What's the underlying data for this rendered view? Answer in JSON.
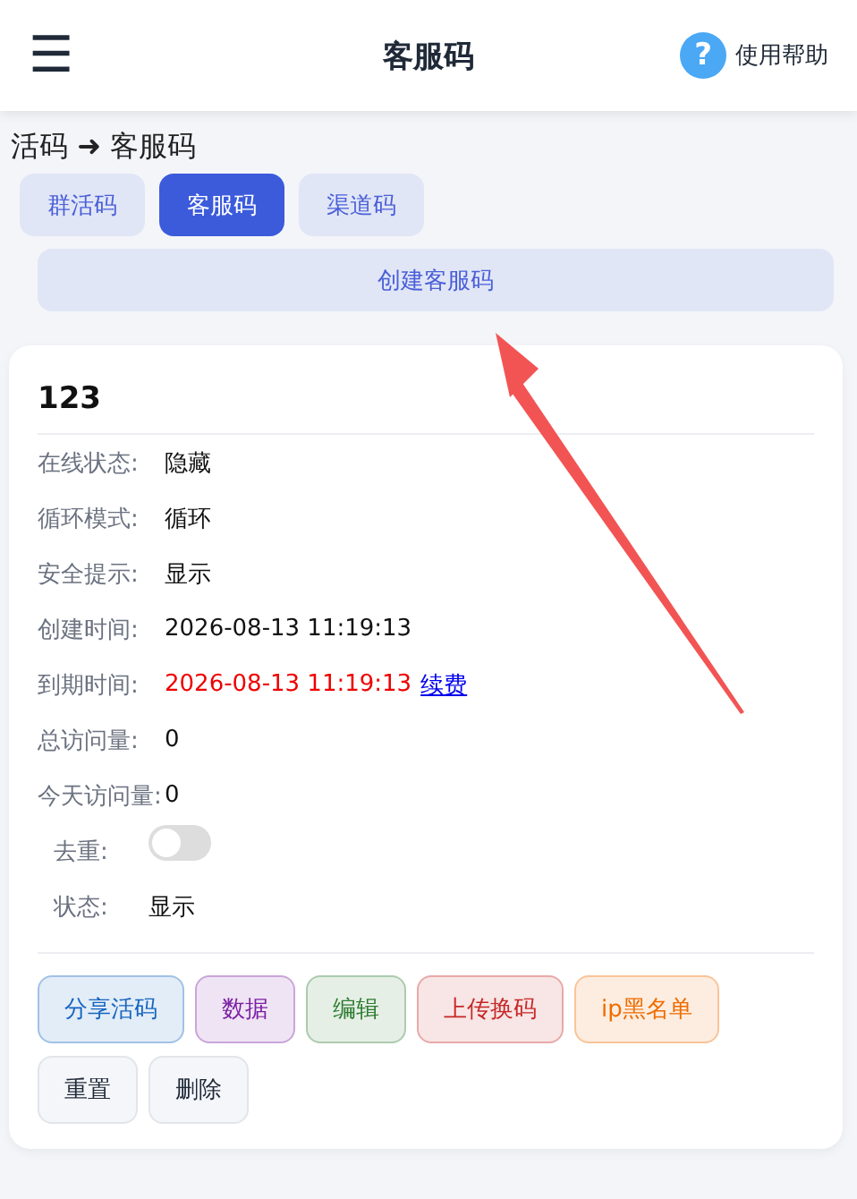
{
  "header": {
    "menu_icon": "☰",
    "title": "客服码",
    "help_icon": "?",
    "help_label": "使用帮助"
  },
  "breadcrumb": "活码 ➜ 客服码",
  "tabs": [
    {
      "label": "群活码",
      "selected": false
    },
    {
      "label": "客服码",
      "selected": true
    },
    {
      "label": "渠道码",
      "selected": false
    }
  ],
  "create_button": "创建客服码",
  "card": {
    "title": "123",
    "fields": [
      {
        "kind": "text",
        "label": "在线状态:",
        "value": "隐藏"
      },
      {
        "kind": "text",
        "label": "循环模式:",
        "value": "循环"
      },
      {
        "kind": "text",
        "label": "安全提示:",
        "value": "显示"
      },
      {
        "kind": "text",
        "label": "创建时间:",
        "value": "2026-08-13 11:19:13"
      },
      {
        "kind": "expiry",
        "label": "到期时间:",
        "value": "2026-08-13 11:19:13",
        "link": "续费"
      },
      {
        "kind": "text",
        "label": "总访问量:",
        "value": "0"
      },
      {
        "kind": "text",
        "label": "今天访问量:",
        "value": "0"
      }
    ],
    "settings": [
      {
        "kind": "toggle",
        "label": "去重:",
        "on": false
      },
      {
        "kind": "text",
        "label": "状态:",
        "value": "显示"
      }
    ],
    "actions": [
      {
        "label": "分享活码",
        "color": "#1565c0"
      },
      {
        "label": "数据",
        "color": "#7b1fa2"
      },
      {
        "label": "编辑",
        "color": "#2e7d32"
      },
      {
        "label": "上传换码",
        "color": "#c62828"
      },
      {
        "label": "ip黑名单",
        "color": "#ef6c00"
      },
      {
        "label": "重置",
        "color": "#1f2937"
      },
      {
        "label": "删除",
        "color": "#1f2937"
      }
    ]
  }
}
